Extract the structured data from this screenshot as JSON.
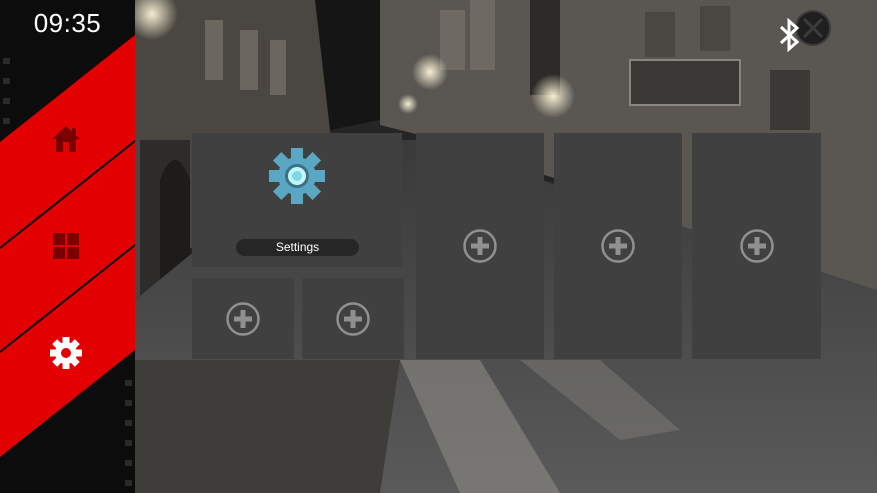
{
  "status_bar": {
    "clock": "09:35",
    "bluetooth_icon": "bluetooth-icon",
    "close_icon": "close-icon"
  },
  "sidebar": {
    "accent_color": "#e20000",
    "background_color": "#0c0c0c",
    "items": [
      {
        "icon": "home-icon",
        "active": false
      },
      {
        "icon": "apps-grid-icon",
        "active": false
      },
      {
        "icon": "gear-icon",
        "active": true
      }
    ]
  },
  "tiles": {
    "background_color": "#404040",
    "settings_tile": {
      "label": "Settings",
      "icon": "settings-gear-icon"
    },
    "empty_slot_icon": "plus-icon"
  }
}
